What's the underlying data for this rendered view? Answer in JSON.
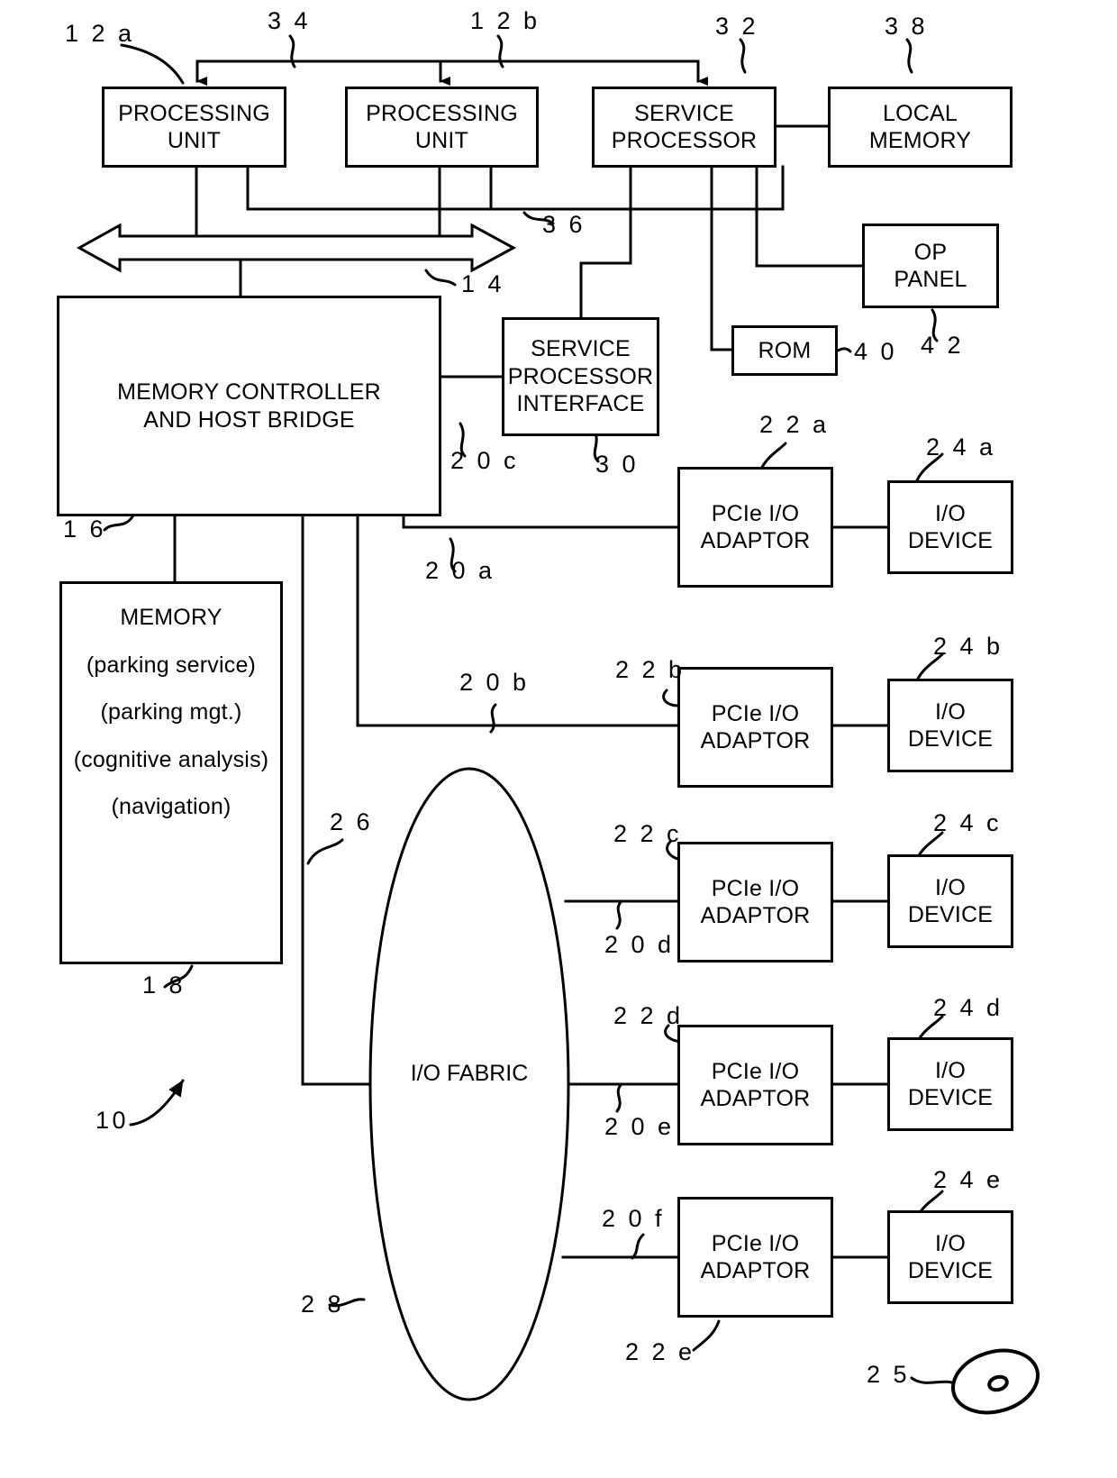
{
  "figure": {
    "type": "patent-block-diagram",
    "reference_numeral_overall": "10"
  },
  "blocks": {
    "processing_unit_a": {
      "line1": "PROCESSING",
      "line2": "UNIT",
      "ref": "1 2 a"
    },
    "processing_unit_b": {
      "line1": "PROCESSING",
      "line2": "UNIT",
      "ref": "1 2 b"
    },
    "service_processor": {
      "line1": "SERVICE",
      "line2": "PROCESSOR",
      "ref": "3 2"
    },
    "local_memory": {
      "line1": "LOCAL",
      "line2": "MEMORY",
      "ref": "3 8"
    },
    "op_panel": {
      "line1": "OP",
      "line2": "PANEL",
      "ref": "4 2"
    },
    "rom": {
      "line1": "ROM",
      "ref": "4 0"
    },
    "memory_controller": {
      "line1": "MEMORY CONTROLLER",
      "line2": "AND HOST BRIDGE",
      "ref": "1 6"
    },
    "service_processor_interface": {
      "line1": "SERVICE",
      "line2": "PROCESSOR",
      "line3": "INTERFACE",
      "ref": "3 0"
    },
    "memory": {
      "title": "MEMORY",
      "items": [
        "(parking service)",
        "(parking mgt.)",
        "(cognitive analysis)",
        "(navigation)"
      ],
      "ref": "1 8"
    },
    "io_fabric": {
      "line1": "I/O",
      "line2": "FABRIC",
      "ref": "2 8"
    }
  },
  "adaptors": [
    {
      "line1": "PCIe I/O",
      "line2": "ADAPTOR",
      "ref": "2 2 a"
    },
    {
      "line1": "PCIe I/O",
      "line2": "ADAPTOR",
      "ref": "2 2 b"
    },
    {
      "line1": "PCIe I/O",
      "line2": "ADAPTOR",
      "ref": "2 2 c"
    },
    {
      "line1": "PCIe I/O",
      "line2": "ADAPTOR",
      "ref": "2 2 d"
    },
    {
      "line1": "PCIe I/O",
      "line2": "ADAPTOR",
      "ref": "2 2 e"
    }
  ],
  "devices": [
    {
      "line1": "I/O",
      "line2": "DEVICE",
      "ref": "2 4 a"
    },
    {
      "line1": "I/O",
      "line2": "DEVICE",
      "ref": "2 4 b"
    },
    {
      "line1": "I/O",
      "line2": "DEVICE",
      "ref": "2 4 c"
    },
    {
      "line1": "I/O",
      "line2": "DEVICE",
      "ref": "2 4 d"
    },
    {
      "line1": "I/O",
      "line2": "DEVICE",
      "ref": "2 4 e"
    }
  ],
  "bus_refs": {
    "interrupt_bus_34": "3 4",
    "system_bus_14": "1 4",
    "service_bus_36": "3 6",
    "link_20a": "2 0 a",
    "link_20b": "2 0 b",
    "link_20c": "2 0 c",
    "link_20d": "2 0 d",
    "link_20e": "2 0 e",
    "link_20f": "2 0 f",
    "link_26": "2 6"
  },
  "disc_media": {
    "ref": "2 5"
  }
}
